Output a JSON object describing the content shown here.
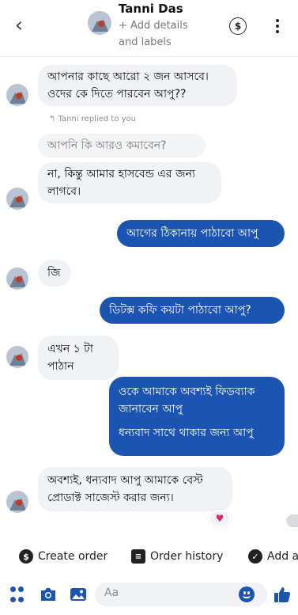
{
  "header": {
    "contact_name": "Tanni Das",
    "subtitle": "+ Add details and labels",
    "back_icon": "chevron-left-icon",
    "dollar_icon": "dollar-circle-icon",
    "menu_icon": "more-vertical-icon"
  },
  "messages": [
    {
      "text": "আপনার কাছে আরো ২ জন আসবে। ওদের কে দিতে পারবেন আপু??"
    },
    {
      "text": "Tanni replied to you"
    },
    {
      "text": "আপনি কি আরও কমাবেন?"
    },
    {
      "text": "না, কিন্তু আমার হাসবেন্ড এর জন্য লাগবে।"
    },
    {
      "text": "আগের ঠিকানায় পাঠাবো আপু"
    },
    {
      "text": "জি"
    },
    {
      "text": "ডিটক্স কফি কয়টা পাঠাবো আপু?"
    },
    {
      "text": "এখন ১ টা পাঠান"
    },
    {
      "text": "ওকে আমাকে অবশ্যই ফিডব্যাক জানাবেন আপু"
    },
    {
      "text": "ধন্যবাদ সাথে থাকার জন্য আপু"
    },
    {
      "text": "অবশ্যই, ধন্যবাদ আপু আমাকে বেস্ট প্রোডাক্ট সাজেস্ট করার জন্য।"
    }
  ],
  "quick_actions": {
    "create_order": "Create order",
    "order_history": "Order history",
    "add": "Add a"
  },
  "composer": {
    "placeholder": "Aa"
  },
  "colors": {
    "accent": "#1c54b2",
    "incoming_bubble": "#f0f2f5",
    "reaction_heart": "#e0245e"
  }
}
